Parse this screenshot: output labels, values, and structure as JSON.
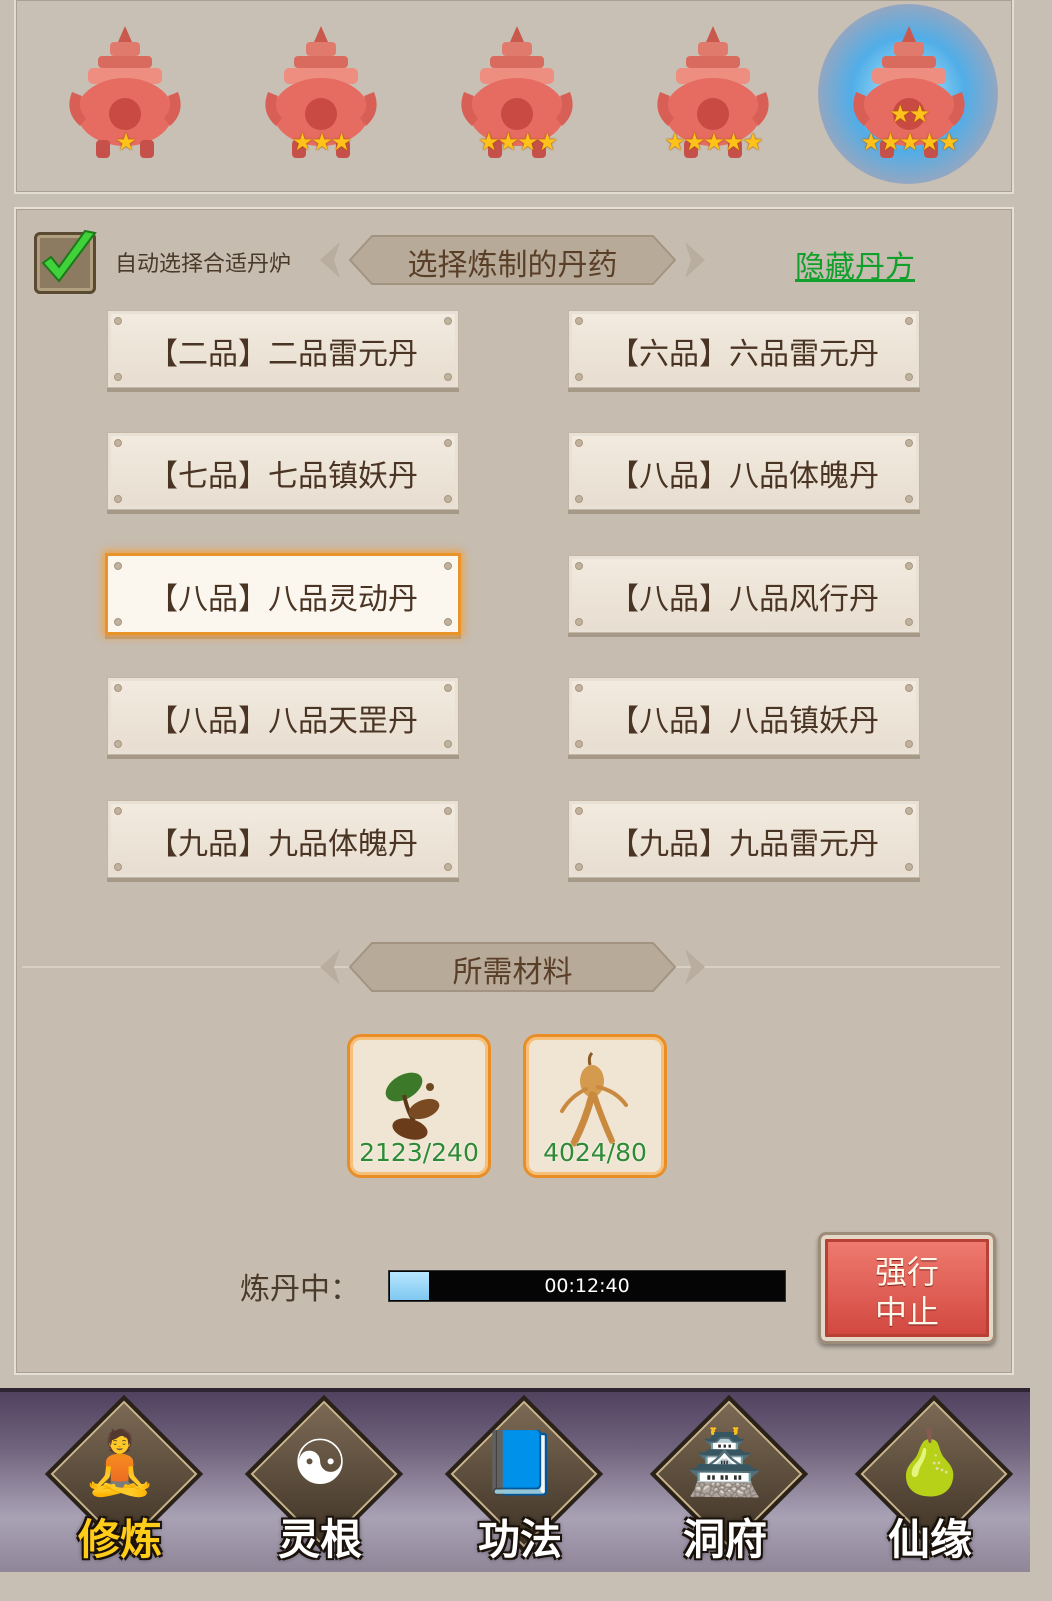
{
  "furnaces": [
    {
      "stars": 1,
      "star_text": "★"
    },
    {
      "stars": 3,
      "star_text": "★★★"
    },
    {
      "stars": 4,
      "star_text": "★★★★"
    },
    {
      "stars": 5,
      "star_text": "★★★★★"
    },
    {
      "stars": 5,
      "star_text": "★★★★★",
      "selected": true,
      "top_stars": "★★"
    }
  ],
  "selector": {
    "auto_select_label": "自动选择合适丹炉",
    "auto_select_checked": true,
    "title": "选择炼制的丹药",
    "hidden_recipe_link": "隐藏丹方"
  },
  "pills": [
    {
      "label": "【二品】二品雷元丹"
    },
    {
      "label": "【六品】六品雷元丹"
    },
    {
      "label": "【七品】七品镇妖丹"
    },
    {
      "label": "【八品】八品体魄丹"
    },
    {
      "label": "【八品】八品灵动丹",
      "selected": true
    },
    {
      "label": "【八品】八品风行丹"
    },
    {
      "label": "【八品】八品天罡丹"
    },
    {
      "label": "【八品】八品镇妖丹"
    },
    {
      "label": "【九品】九品体魄丹"
    },
    {
      "label": "【九品】九品雷元丹"
    }
  ],
  "materials": {
    "title": "所需材料",
    "items": [
      {
        "icon": "herb-root-icon",
        "count": "2123/240"
      },
      {
        "icon": "ginseng-icon",
        "count": "4024/80"
      }
    ]
  },
  "refining": {
    "label": "炼丹中：",
    "time": "00:12:40",
    "progress": 0.1,
    "abort_line1": "强行",
    "abort_line2": "中止"
  },
  "nav": [
    {
      "label": "修炼",
      "icon": "monk-icon",
      "active": true
    },
    {
      "label": "灵根",
      "icon": "yin-yang-sword-icon"
    },
    {
      "label": "功法",
      "icon": "book-icon"
    },
    {
      "label": "洞府",
      "icon": "palace-icon"
    },
    {
      "label": "仙缘",
      "icon": "gourd-icon"
    }
  ],
  "colors": {
    "background": "#c8bfb4",
    "link_green": "#12a02c",
    "selected_border": "#e9942b",
    "abort_red": "#d0453d",
    "active_nav": "#ffcc1a"
  }
}
